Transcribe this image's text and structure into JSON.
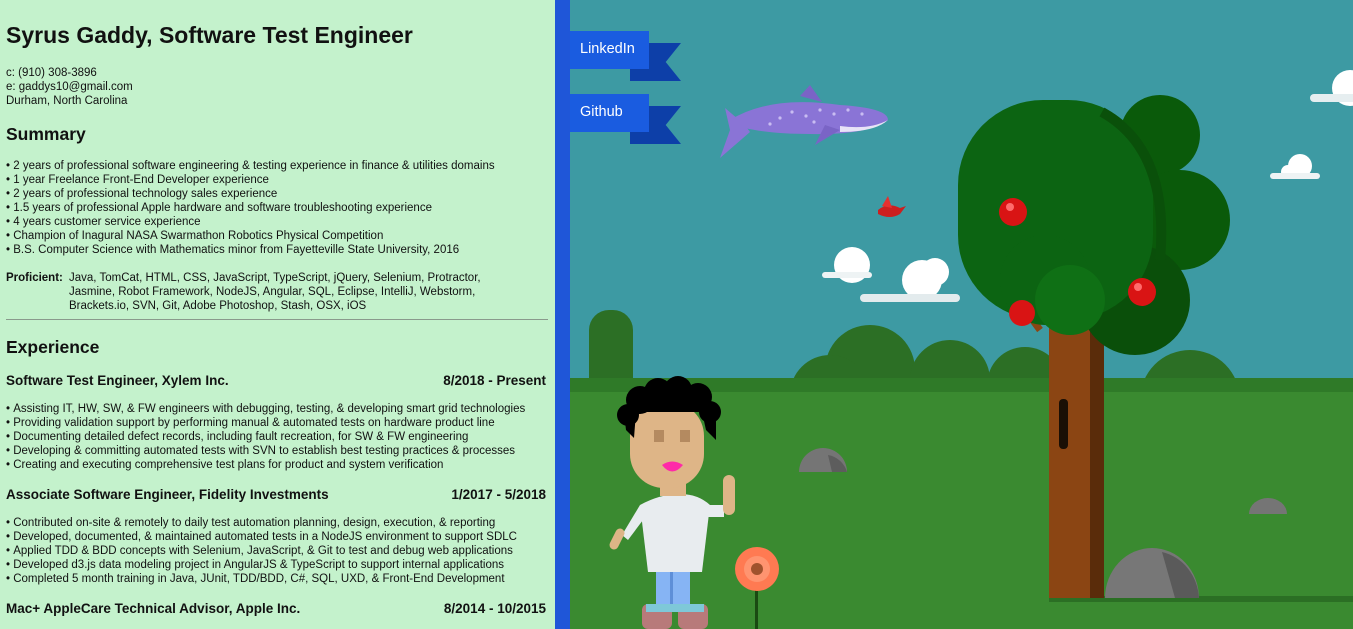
{
  "resume": {
    "name": "Syrus Gaddy, Software Test Engineer",
    "contact": {
      "phone": "c: (910) 308-3896",
      "email": "e: gaddys10@gmail.com",
      "location": "Durham, North Carolina"
    },
    "summary": {
      "title": "Summary",
      "items": [
        "2 years of professional software engineering & testing experience in finance & utilities domains",
        "1 year Freelance Front-End Developer experience",
        "2 years of professional technology sales experience",
        "1.5 years of professional Apple hardware and software troubleshooting experience",
        "4 years customer service experience",
        "Champion of Inagural NASA Swarmathon Robotics Physical Competition",
        "B.S. Computer Science with Mathematics minor from Fayetteville State University, 2016"
      ],
      "proficient_label": "Proficient:",
      "proficient_value": "Java, TomCat, HTML, CSS, JavaScript, TypeScript, jQuery, Selenium, Protractor, Jasmine, Robot Framework, NodeJS, Angular, SQL, Eclipse, IntelliJ, Webstorm, Brackets.io, SVN, Git, Adobe Photoshop, Stash, OSX, iOS"
    },
    "experience": {
      "title": "Experience",
      "jobs": [
        {
          "title": "Software Test Engineer, Xylem Inc.",
          "dates": "8/2018 - Present",
          "items": [
            "Assisting IT, HW, SW, & FW engineers with debugging, testing, & developing smart grid technologies",
            "Providing validation support by performing manual & automated tests on hardware product line",
            "Documenting detailed defect records, including fault recreation, for SW & FW engineering",
            "Developing & committing automated tests with SVN to establish best testing practices & processes",
            "Creating and executing comprehensive test plans for product and system verification"
          ]
        },
        {
          "title": "Associate Software Engineer, Fidelity Investments",
          "dates": "1/2017 - 5/2018",
          "items": [
            "Contributed on-site & remotely to daily test automation planning, design, execution, & reporting",
            "Developed, documented, & maintained automated tests in a NodeJS environment to support SDLC",
            "Applied TDD & BDD concepts with Selenium, JavaScript, & Git to test and debug web applications",
            "Developed d3.js data modeling project in AngularJS & TypeScript to support internal applications",
            "Completed 5 month training in Java, JUnit, TDD/BDD, C#, SQL, UXD, & Front-End Development"
          ]
        },
        {
          "title": "Mac+ AppleCare Technical Advisor, Apple Inc.",
          "dates": "8/2014 - 10/2015",
          "items": []
        }
      ]
    }
  },
  "links": {
    "linkedin": "LinkedIn",
    "github": "Github"
  },
  "colors": {
    "resume_bg": "#c4f2cc",
    "accent_blue": "#1f56d8",
    "sky": "#3d9aa3",
    "grass": "#3a8a30"
  }
}
